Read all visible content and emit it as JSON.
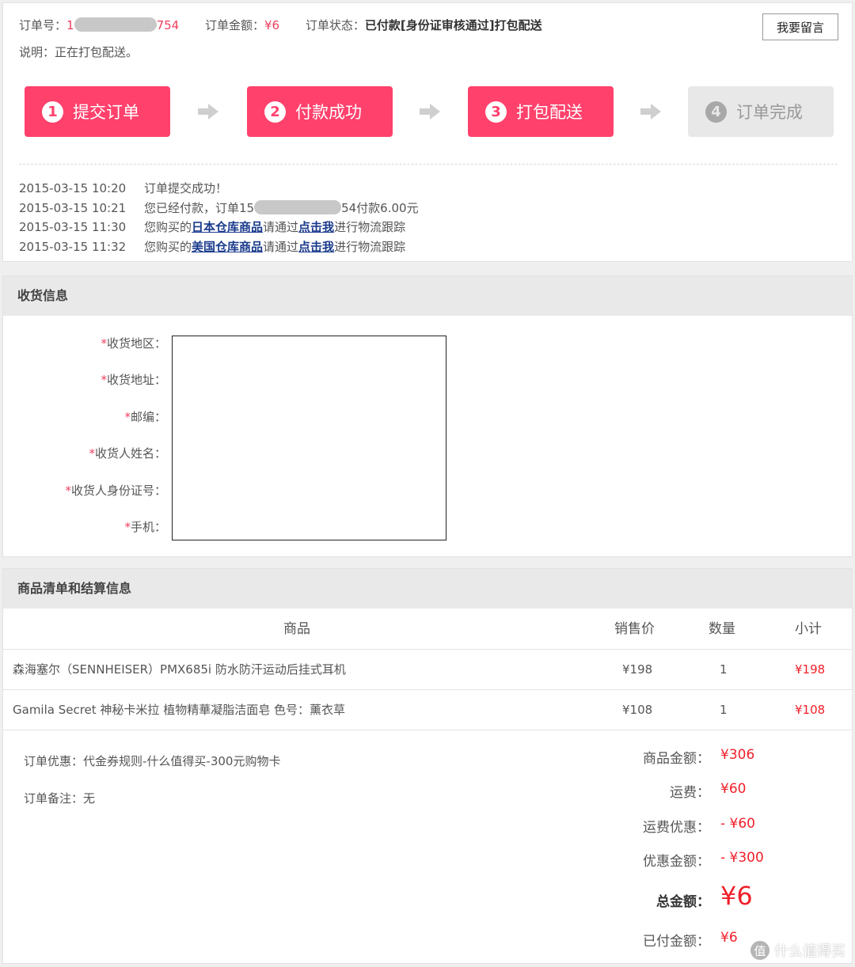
{
  "order": {
    "number_label": "订单号：",
    "number_prefix": "1",
    "number_suffix": "754",
    "amount_label": "订单金额：",
    "amount": "¥6",
    "status_label": "订单状态：",
    "status": "已付款[身份证审核通过]打包配送",
    "note": "说明：正在打包配送。",
    "message_button": "我要留言"
  },
  "steps": [
    {
      "num": "1",
      "label": "提交订单",
      "active": true
    },
    {
      "num": "2",
      "label": "付款成功",
      "active": true
    },
    {
      "num": "3",
      "label": "打包配送",
      "active": true
    },
    {
      "num": "4",
      "label": "订单完成",
      "active": false
    }
  ],
  "log": [
    {
      "time": "2015-03-15 10:20",
      "text": "订单提交成功！"
    },
    {
      "time": "2015-03-15 10:21",
      "pre": "您已经付款，订单15",
      "post": "54付款6.00元"
    },
    {
      "time": "2015-03-15 11:30",
      "pre": "您购买的",
      "link": "日本仓库商品",
      "mid": "请通过",
      "link2": "点击我",
      "post": "进行物流跟踪"
    },
    {
      "time": "2015-03-15 11:32",
      "pre": "您购买的",
      "link": "美国仓库商品",
      "mid": "请通过",
      "link2": "点击我",
      "post": "进行物流跟踪"
    }
  ],
  "shipping": {
    "title": "收货信息",
    "fields": [
      "收货地区：",
      "收货地址：",
      "邮编：",
      "收货人姓名：",
      "收货人身份证号：",
      "手机："
    ]
  },
  "goods": {
    "title": "商品清单和结算信息",
    "columns": {
      "name": "商品",
      "price": "销售价",
      "qty": "数量",
      "subtotal": "小计"
    },
    "rows": [
      {
        "name": "森海塞尔（SENNHEISER）PMX685i 防水防汗运动后挂式耳机",
        "price": "¥198",
        "qty": "1",
        "subtotal": "¥198"
      },
      {
        "name": "Gamila Secret 神秘卡米拉 植物精華凝脂洁面皂  色号：薰衣草",
        "price": "¥108",
        "qty": "1",
        "subtotal": "¥108"
      }
    ],
    "discount_note": "订单优惠：代金券规则-什么值得买-300元购物卡",
    "remark": "订单备注：无",
    "summary": [
      {
        "key": "商品金额：",
        "value": "¥306"
      },
      {
        "key": "运费：",
        "value": "¥60"
      },
      {
        "key": "运费优惠：",
        "value": "- ¥60"
      },
      {
        "key": "优惠金额：",
        "value": "- ¥300"
      },
      {
        "key": "总金额：",
        "value": "¥6"
      },
      {
        "key": "已付金额：",
        "value": "¥6"
      }
    ]
  },
  "watermark": {
    "badge": "值",
    "text": "什么值得买"
  },
  "colors": {
    "accent": "#ff416c",
    "price_red": "#f0202a",
    "link": "#1a3b8c"
  }
}
